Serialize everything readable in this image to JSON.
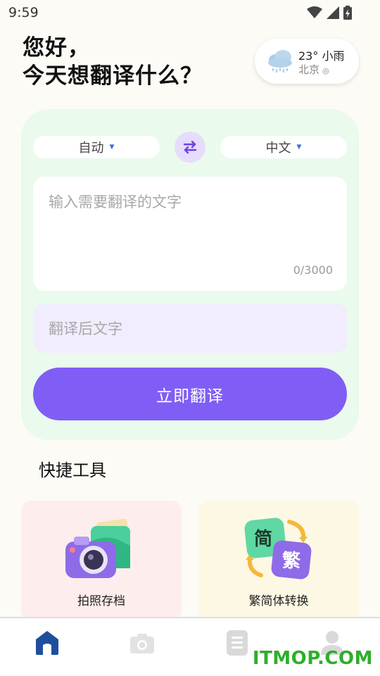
{
  "status_bar": {
    "time": "9:59",
    "icons": [
      "wifi-icon",
      "cellular-icon",
      "battery-charging-icon"
    ]
  },
  "header": {
    "greeting_line1": "您好，",
    "greeting_line2": "今天想翻译什么？"
  },
  "weather": {
    "icon": "rain-cloud-icon",
    "temperature": "23°",
    "condition": "小雨",
    "city": "北京",
    "location_icon": "location-pin-icon"
  },
  "translator": {
    "source_language": "自动",
    "target_language": "中文",
    "swap_icon": "swap-arrows-icon",
    "input_placeholder": "输入需要翻译的文字",
    "char_count": "0/3000",
    "output_placeholder": "翻译后文字",
    "translate_label": "立即翻译"
  },
  "tools": {
    "title": "快捷工具",
    "items": [
      {
        "label": "拍照存档",
        "icon": "camera-photo-icon"
      },
      {
        "label": "繁简体转换",
        "icon": "traditional-simplified-icon",
        "glyph_simplified": "简",
        "glyph_traditional": "繁"
      }
    ]
  },
  "bottom_nav": {
    "items": [
      {
        "name": "home",
        "icon": "home-icon",
        "active": true
      },
      {
        "name": "camera",
        "icon": "camera-icon",
        "active": false
      },
      {
        "name": "list",
        "icon": "document-list-icon",
        "active": false
      },
      {
        "name": "profile",
        "icon": "person-icon",
        "active": false
      }
    ]
  },
  "watermark": "ITMOP.COM",
  "colors": {
    "accent": "#805ef5",
    "panel_bg": "#eafaec",
    "home_active": "#1e4f9c",
    "watermark": "#2fae2c"
  }
}
